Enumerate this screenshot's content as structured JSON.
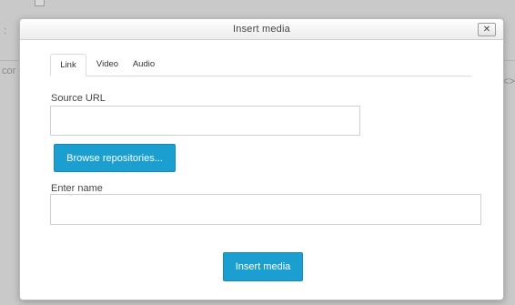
{
  "background": {
    "left_fragment_top": ":",
    "left_fragment_mid": "cor",
    "right_fragment": "<>"
  },
  "dialog": {
    "title": "Insert media",
    "close_glyph": "✕"
  },
  "tabs": [
    {
      "label": "Link",
      "active": true
    },
    {
      "label": "Video",
      "active": false
    },
    {
      "label": "Audio",
      "active": false
    }
  ],
  "form": {
    "source_url_label": "Source URL",
    "source_url_value": "",
    "browse_label": "Browse repositories...",
    "name_label": "Enter name",
    "name_value": ""
  },
  "footer": {
    "insert_label": "Insert media"
  },
  "colors": {
    "primary": "#1a9fd0",
    "backdrop": "#c9c9c9"
  }
}
